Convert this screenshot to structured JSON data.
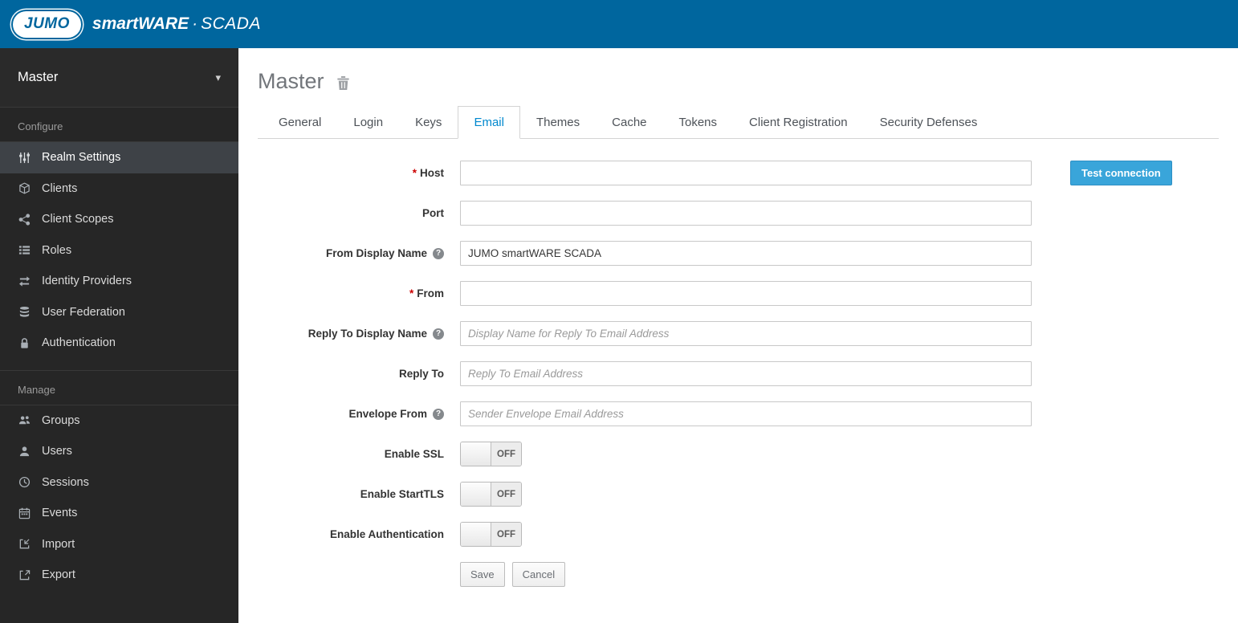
{
  "colors": {
    "header_bg": "#00669e",
    "accent": "#39a5da",
    "link_blue": "#0088ce",
    "sidebar_active": "#3e4247",
    "required_red": "#cc0000"
  },
  "header": {
    "logo_text": "JUMO",
    "brand_primary": "smartWARE",
    "brand_separator": "·",
    "brand_secondary": "SCADA"
  },
  "sidebar": {
    "realm_selector": {
      "label": "Master",
      "icon": "chevron-down-icon"
    },
    "sections": [
      {
        "label": "Configure",
        "items": [
          {
            "label": "Realm Settings",
            "icon": "sliders-icon",
            "active": true
          },
          {
            "label": "Clients",
            "icon": "cube-icon"
          },
          {
            "label": "Client Scopes",
            "icon": "scopes-network-icon"
          },
          {
            "label": "Roles",
            "icon": "list-icon"
          },
          {
            "label": "Identity Providers",
            "icon": "arrows-swap-icon"
          },
          {
            "label": "User Federation",
            "icon": "database-icon"
          },
          {
            "label": "Authentication",
            "icon": "lock-icon"
          }
        ]
      },
      {
        "label": "Manage",
        "items": [
          {
            "label": "Groups",
            "icon": "groups-icon"
          },
          {
            "label": "Users",
            "icon": "user-icon"
          },
          {
            "label": "Sessions",
            "icon": "clock-icon"
          },
          {
            "label": "Events",
            "icon": "calendar-icon"
          },
          {
            "label": "Import",
            "icon": "import-icon"
          },
          {
            "label": "Export",
            "icon": "export-icon"
          }
        ]
      }
    ]
  },
  "main": {
    "title": "Master",
    "title_icon": "trash-icon",
    "tabs": [
      {
        "label": "General"
      },
      {
        "label": "Login"
      },
      {
        "label": "Keys"
      },
      {
        "label": "Email",
        "active": true
      },
      {
        "label": "Themes"
      },
      {
        "label": "Cache"
      },
      {
        "label": "Tokens"
      },
      {
        "label": "Client Registration"
      },
      {
        "label": "Security Defenses"
      }
    ],
    "form": {
      "host": {
        "label": "Host",
        "required": "*",
        "value": ""
      },
      "port": {
        "label": "Port",
        "value": ""
      },
      "from_display_name": {
        "label": "From Display Name",
        "help_icon": "question-icon",
        "value": "JUMO smartWARE SCADA"
      },
      "from": {
        "label": "From",
        "required": "*",
        "value": ""
      },
      "reply_to_display_name": {
        "label": "Reply To Display Name",
        "help_icon": "question-icon",
        "placeholder": "Display Name for Reply To Email Address",
        "value": ""
      },
      "reply_to": {
        "label": "Reply To",
        "placeholder": "Reply To Email Address",
        "value": ""
      },
      "envelope_from": {
        "label": "Envelope From",
        "help_icon": "question-icon",
        "placeholder": "Sender Envelope Email Address",
        "value": ""
      },
      "enable_ssl": {
        "label": "Enable SSL",
        "state": "OFF"
      },
      "enable_starttls": {
        "label": "Enable StartTLS",
        "state": "OFF"
      },
      "enable_authentication": {
        "label": "Enable Authentication",
        "state": "OFF"
      },
      "test_connection_label": "Test connection",
      "save_label": "Save",
      "cancel_label": "Cancel"
    }
  }
}
